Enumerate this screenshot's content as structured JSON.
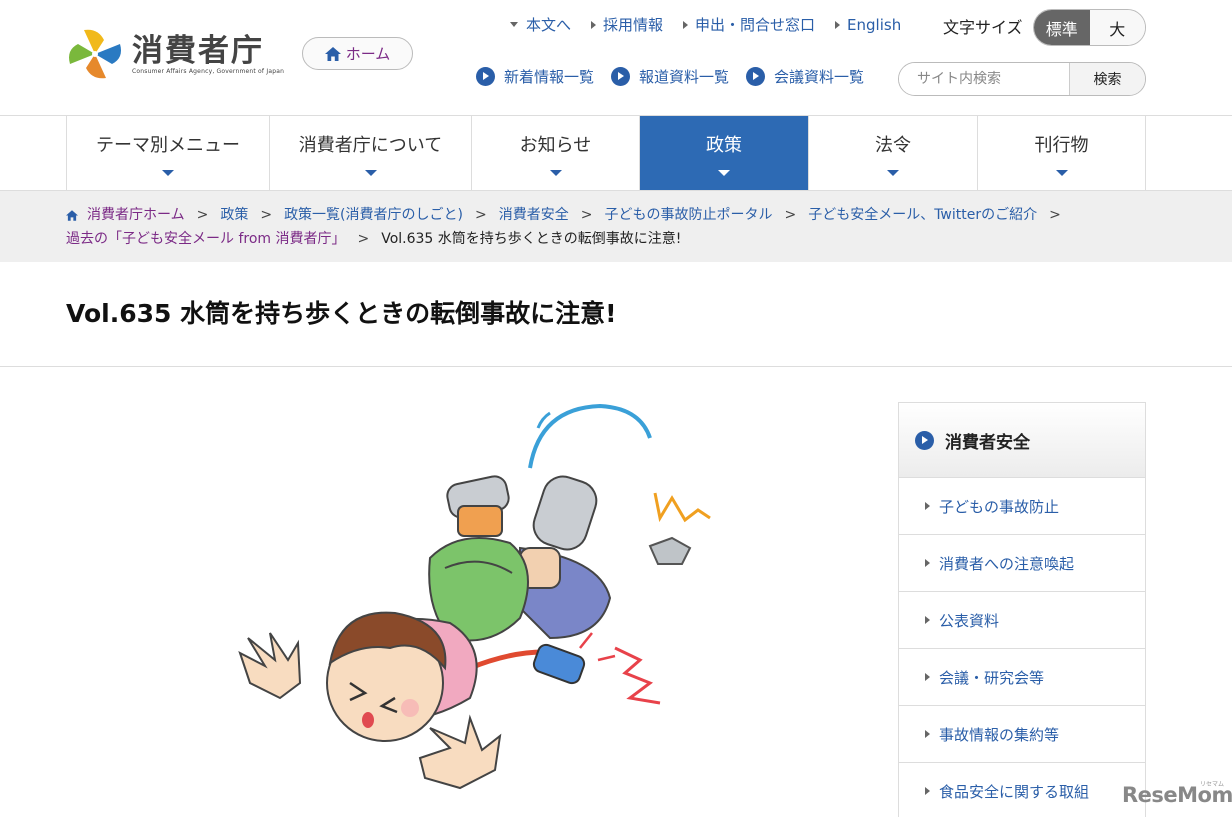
{
  "site": {
    "logo_name": "消費者庁",
    "logo_sub": "Consumer Affairs Agency, Government of Japan",
    "home_label": "ホーム"
  },
  "util_links": [
    "本文へ",
    "採用情報",
    "申出・問合せ窓口",
    "English"
  ],
  "font_size": {
    "label": "文字サイズ",
    "standard": "標準",
    "large": "大"
  },
  "sub_links": [
    "新着情報一覧",
    "報道資料一覧",
    "会議資料一覧"
  ],
  "search": {
    "placeholder": "サイト内検索",
    "button": "検索"
  },
  "gnav": [
    {
      "label": "テーマ別メニュー",
      "active": false
    },
    {
      "label": "消費者庁について",
      "active": false
    },
    {
      "label": "お知らせ",
      "active": false
    },
    {
      "label": "政策",
      "active": true
    },
    {
      "label": "法令",
      "active": false
    },
    {
      "label": "刊行物",
      "active": false
    }
  ],
  "breadcrumb": {
    "items": [
      "消費者庁ホーム",
      "政策",
      "政策一覧(消費者庁のしごと)",
      "消費者安全",
      "子どもの事故防止ポータル",
      "子ども安全メール、Twitterのご紹介",
      "過去の「子ども安全メール from 消費者庁」"
    ],
    "current": "Vol.635 水筒を持ち歩くときの転倒事故に注意!"
  },
  "page_title": "Vol.635 水筒を持ち歩くときの転倒事故に注意!",
  "side_menu": {
    "title": "消費者安全",
    "items": [
      "子どもの事故防止",
      "消費者への注意喚起",
      "公表資料",
      "会議・研究会等",
      "事故情報の集約等",
      "食品安全に関する取組"
    ]
  },
  "watermark": {
    "text": "ReseMom",
    "sub": "リセマム"
  },
  "colors": {
    "brand_blue": "#2d6ab4",
    "link_blue": "#2a5ea8",
    "visited_purple": "#7b2a86"
  }
}
